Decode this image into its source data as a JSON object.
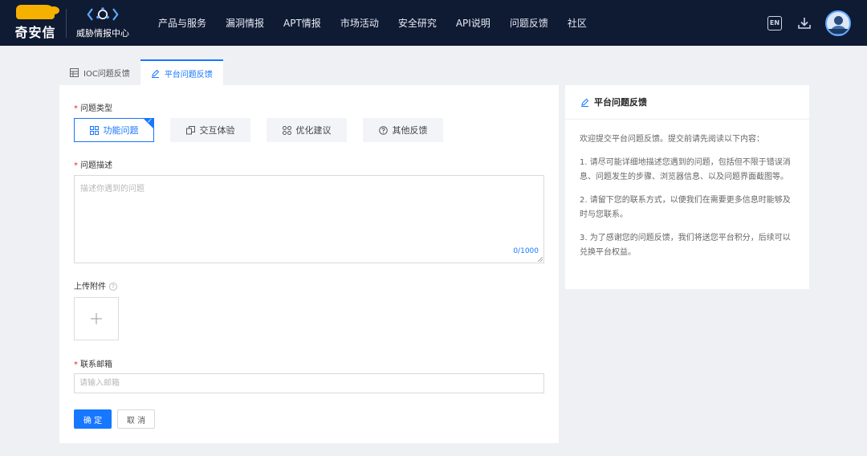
{
  "brand": {
    "company": "奇安信",
    "product": "威胁情报中心"
  },
  "nav": {
    "items": [
      "产品与服务",
      "漏洞情报",
      "APT情报",
      "市场活动",
      "安全研究",
      "API说明",
      "问题反馈",
      "社区"
    ],
    "lang": "EN"
  },
  "tabs": [
    {
      "label": "IOC问题反馈",
      "icon": "table-icon"
    },
    {
      "label": "平台问题反馈",
      "icon": "edit-icon",
      "active": true
    }
  ],
  "form": {
    "type_label": "问题类型",
    "types": [
      {
        "label": "功能问题",
        "icon": "grid-icon",
        "selected": true
      },
      {
        "label": "交互体验",
        "icon": "copy-icon"
      },
      {
        "label": "优化建议",
        "icon": "nodes-icon"
      },
      {
        "label": "其他反馈",
        "icon": "question-circle-icon"
      }
    ],
    "desc_label": "问题描述",
    "desc_placeholder": "描述你遇到的问题",
    "desc_count": "0/1000",
    "upload_label": "上传附件",
    "email_label": "联系邮箱",
    "email_placeholder": "请输入邮箱",
    "ok_label": "确 定",
    "cancel_label": "取 消"
  },
  "info": {
    "title": "平台问题反馈",
    "intro": "欢迎提交平台问题反馈。提交前请先阅读以下内容：",
    "p1": "1. 请尽可能详细地描述您遇到的问题，包括但不限于错误消息、问题发生的步骤、浏览器信息、以及问题界面截图等。",
    "p2": "2. 请留下您的联系方式，以便我们在需要更多信息时能够及时与您联系。",
    "p3": "3. 为了感谢您的问题反馈，我们将送您平台积分，后续可以兑换平台权益。"
  },
  "colors": {
    "nav_bg": "#0f1a33",
    "accent": "#1677ff",
    "required": "#f5222d"
  }
}
